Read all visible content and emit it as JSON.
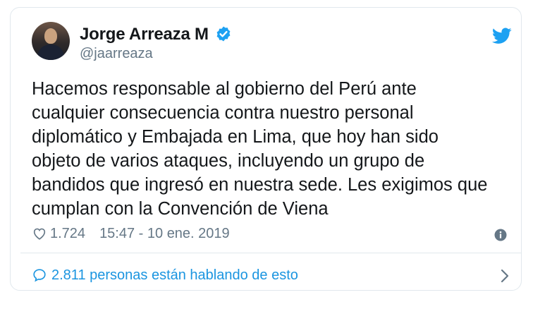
{
  "author": {
    "display_name": "Jorge Arreaza M",
    "handle": "@jaarreaza",
    "verified_icon": "verified-badge-icon"
  },
  "platform_icon": "twitter-bird-icon",
  "tweet": {
    "text": "Hacemos responsable al gobierno del Perú ante\ncualquier consecuencia contra nuestro personal\ndiplomático y Embajada en Lima, que hoy han sido\nobjeto de varios ataques, incluyendo un grupo de\nbandidos que ingresó en nuestra sede. Les exigimos que\ncumplan con la Convención de Viena",
    "likes": "1.724",
    "timestamp": "15:47 - 10 ene. 2019"
  },
  "conversation": {
    "label": "2.811 personas están hablando de esto"
  },
  "colors": {
    "accent": "#1b95e0",
    "muted": "#657786",
    "text": "#14171a",
    "border": "#e1e8ed"
  }
}
